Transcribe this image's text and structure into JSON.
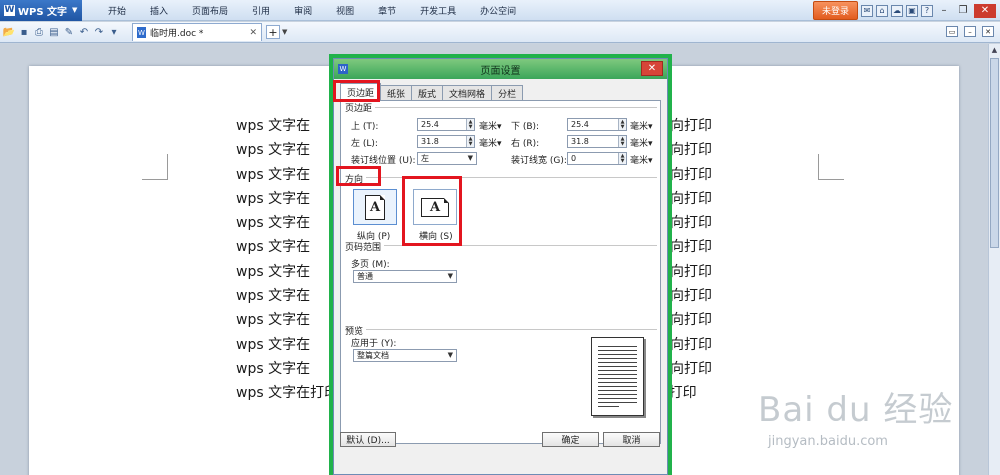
{
  "app": {
    "name": "WPS 文字"
  },
  "menu": {
    "items": [
      "开始",
      "插入",
      "页面布局",
      "引用",
      "审阅",
      "视图",
      "章节",
      "开发工具",
      "办公空间"
    ],
    "login": "未登录"
  },
  "document_tab": {
    "title": "临时用.doc *"
  },
  "document": {
    "lines_left": [
      "wps 文字在",
      "wps 文字在",
      "wps 文字在",
      "wps 文字在",
      "wps 文字在",
      "wps 文字在",
      "wps 文字在",
      "wps 文字在",
      "wps 文字在",
      "wps 文字在",
      "wps 文字在",
      "wps 文字在"
    ],
    "lines_right": [
      "横向打印",
      "横向打印",
      "横向打印",
      "横向打印",
      "横向打印",
      "横向打印",
      "横向打印",
      "横向打印",
      "横向打印",
      "横向打印",
      "横向打印"
    ],
    "last_line": "wps 文字在打印时怎样进行横向打印 wps 文字在打印时怎样进行横向打印"
  },
  "dialog": {
    "title": "页面设置",
    "tabs": [
      "页边距",
      "纸张",
      "版式",
      "文档网格",
      "分栏"
    ],
    "margins": {
      "section": "页边距",
      "top_label": "上 (T):",
      "top_value": "25.4",
      "bottom_label": "下 (B):",
      "bottom_value": "25.4",
      "left_label": "左 (L):",
      "left_value": "31.8",
      "right_label": "右 (R):",
      "right_value": "31.8",
      "gutter_pos_label": "装订线位置 (U):",
      "gutter_pos_value": "左",
      "gutter_width_label": "装订线宽 (G):",
      "gutter_width_value": "0",
      "unit": "毫米"
    },
    "orientation": {
      "section": "方向",
      "portrait": "纵向 (P)",
      "landscape": "横向 (S)",
      "icon_letter": "A"
    },
    "page_range": {
      "section": "页码范围",
      "multi_label": "多页 (M):",
      "multi_value": "普通"
    },
    "preview": {
      "section": "预览",
      "apply_label": "应用于 (Y):",
      "apply_value": "整篇文档"
    },
    "buttons": {
      "default": "默认 (D)...",
      "ok": "确定",
      "cancel": "取消"
    }
  },
  "watermark": {
    "main": "Bai du 经验",
    "sub": "jingyan.baidu.com"
  },
  "colors": {
    "highlight": "#e3151f",
    "dialog_frame": "#21b24b"
  }
}
